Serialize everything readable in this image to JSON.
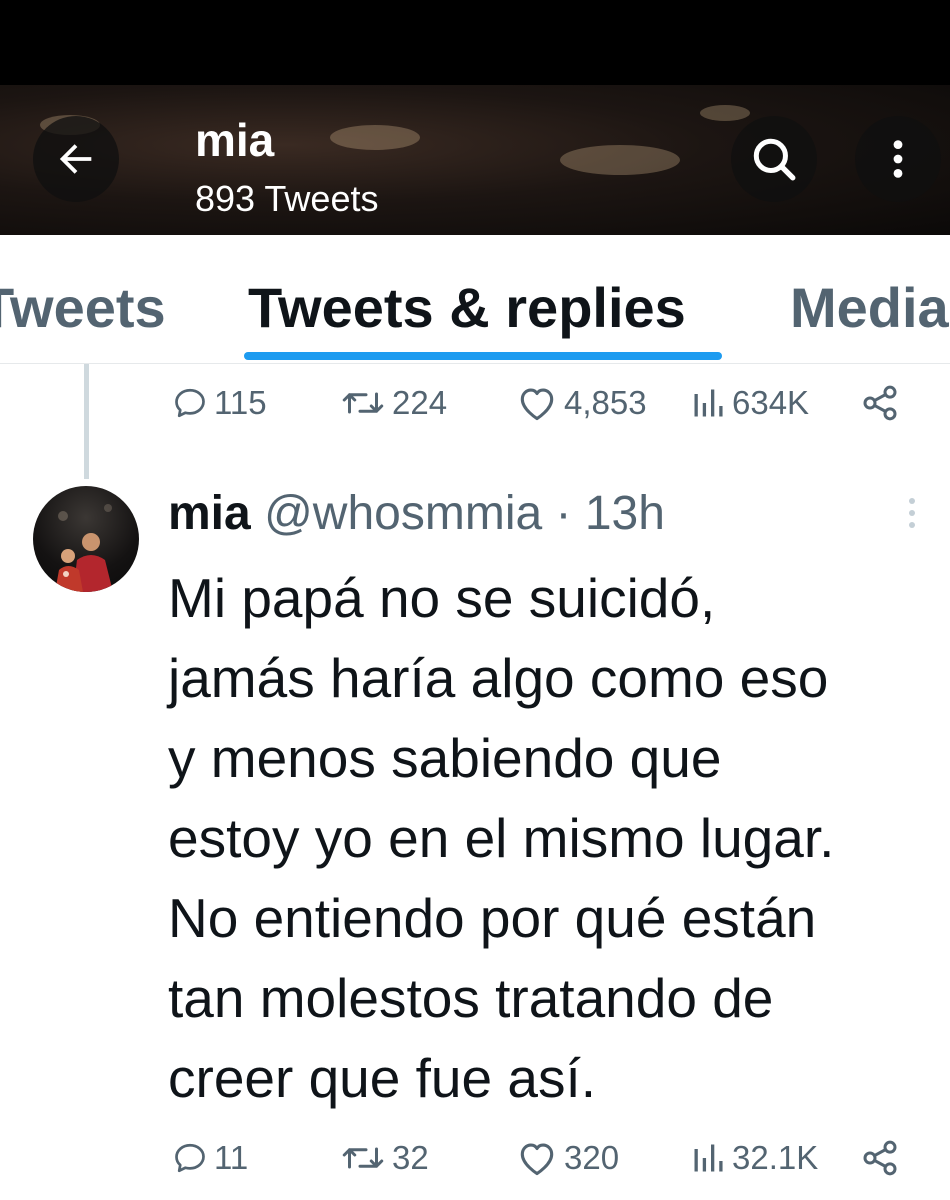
{
  "header": {
    "profile_name": "mia",
    "tweet_count": "893 Tweets",
    "icons": {
      "back": "arrow-left-icon",
      "search": "search-icon",
      "more": "more-vertical-icon"
    }
  },
  "tabs": [
    {
      "label": "Tweets",
      "active": false
    },
    {
      "label": "Tweets & replies",
      "active": true
    },
    {
      "label": "Media",
      "active": false
    }
  ],
  "previous_tweet": {
    "stats": {
      "replies": "115",
      "retweets": "224",
      "likes": "4,853",
      "views": "634K"
    }
  },
  "tweet": {
    "author_name": "mia",
    "handle": "@whosmmia",
    "time": "· 13h",
    "text_lines": [
      "Mi papá no se suicidó,",
      "jamás haría algo como eso",
      "y menos sabiendo que",
      "estoy yo en el mismo lugar.",
      "No entiendo por qué están",
      "tan molestos tratando de",
      "creer que fue así."
    ],
    "stats": {
      "replies": "11",
      "retweets": "32",
      "likes": "320",
      "views": "32.1K"
    }
  },
  "colors": {
    "accent": "#1d9bf0",
    "text_primary": "#0f1419",
    "text_secondary": "#536471"
  }
}
